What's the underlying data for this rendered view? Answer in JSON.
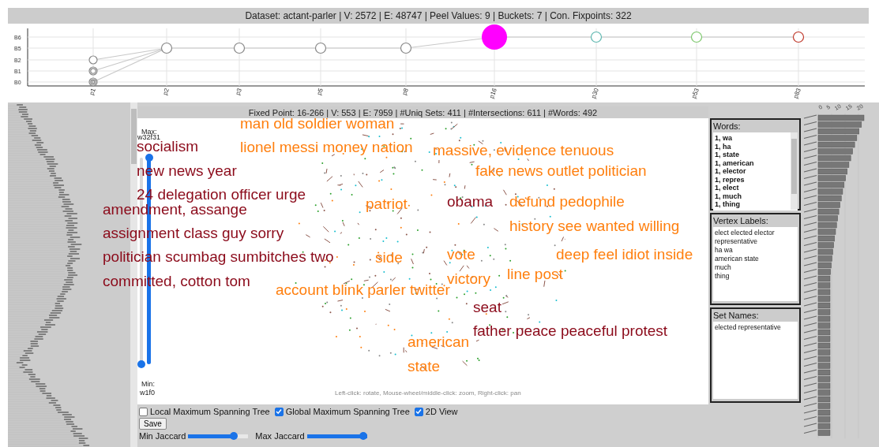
{
  "header": {
    "title": "Dataset: actant-parler | V: 2572 | E: 48747 | Peel Values: 9 | Buckets: 7 | Con. Fixpoints: 322"
  },
  "lattice": {
    "y_labels": [
      "B6",
      "B5",
      "B2",
      "B1",
      "B0"
    ],
    "columns": [
      {
        "label": "p1",
        "nodes": [
          {
            "kind": "spiral",
            "color": "#888888",
            "selected": false
          },
          {
            "kind": "spiral",
            "color": "#888888",
            "selected": false
          },
          {
            "kind": "spiral",
            "color": "#888888",
            "selected": false
          }
        ]
      },
      {
        "label": "p2",
        "nodes": [
          {
            "kind": "circle",
            "color": "#888888",
            "selected": false
          }
        ]
      },
      {
        "label": "p3",
        "nodes": [
          {
            "kind": "circle",
            "color": "#888888",
            "selected": false
          }
        ]
      },
      {
        "label": "p5",
        "nodes": [
          {
            "kind": "circle",
            "color": "#888888",
            "selected": false
          }
        ]
      },
      {
        "label": "p8",
        "nodes": [
          {
            "kind": "circle",
            "color": "#888888",
            "selected": false
          }
        ]
      },
      {
        "label": "p16",
        "nodes": [
          {
            "kind": "circle",
            "color": "#ff00ff",
            "selected": true
          }
        ]
      },
      {
        "label": "p30",
        "nodes": [
          {
            "kind": "circle",
            "color": "#5fb8b0",
            "selected": false
          }
        ]
      },
      {
        "label": "p53",
        "nodes": [
          {
            "kind": "circle",
            "color": "#7ec86e",
            "selected": false
          }
        ]
      },
      {
        "label": "p83",
        "nodes": [
          {
            "kind": "circle",
            "color": "#c0392b",
            "selected": false
          }
        ]
      }
    ]
  },
  "fixed_point": {
    "title": "Fixed Point: 16-266 | V: 553 | E: 7959 | #Uniq Sets: 411 | #Intersections: 611 | #Words: 492",
    "labels": [
      {
        "text": "man old soldier woman",
        "color": "#ff7f0e"
      },
      {
        "text": "socialism",
        "color": "#8b0a1a"
      },
      {
        "text": "lionel messi money nation",
        "color": "#ff7f0e"
      },
      {
        "text": "massive, evidence tenuous",
        "color": "#ff7f0e"
      },
      {
        "text": "new news year",
        "color": "#8b0a1a"
      },
      {
        "text": "fake news outlet politician",
        "color": "#ff7f0e"
      },
      {
        "text": "24 delegation officer urge",
        "color": "#8b0a1a"
      },
      {
        "text": "amendment, assange",
        "color": "#8b0a1a"
      },
      {
        "text": "patriot",
        "color": "#ff7f0e"
      },
      {
        "text": "obama",
        "color": "#8b0a1a"
      },
      {
        "text": "defund pedophile",
        "color": "#ff7f0e"
      },
      {
        "text": "assignment class guy sorry",
        "color": "#8b0a1a"
      },
      {
        "text": "history see wanted willing",
        "color": "#ff7f0e"
      },
      {
        "text": "politician scumbag sumbitches two",
        "color": "#8b0a1a"
      },
      {
        "text": "side",
        "color": "#ff7f0e"
      },
      {
        "text": "vote",
        "color": "#ff7f0e"
      },
      {
        "text": "deep feel idiot inside",
        "color": "#ff7f0e"
      },
      {
        "text": "line post",
        "color": "#ff7f0e"
      },
      {
        "text": "committed, cotton tom",
        "color": "#8b0a1a"
      },
      {
        "text": "victory",
        "color": "#ff7f0e"
      },
      {
        "text": "account blink parler twitter",
        "color": "#ff7f0e"
      },
      {
        "text": "seat",
        "color": "#8b0a1a"
      },
      {
        "text": "father peace peaceful protest",
        "color": "#8b0a1a"
      },
      {
        "text": "american",
        "color": "#ff7f0e"
      },
      {
        "text": "state",
        "color": "#ff7f0e"
      }
    ],
    "range_slider": {
      "max_label": "Max:",
      "max_value": "w32f31",
      "min_label": "Min:",
      "min_value": "w1f0"
    },
    "hint": "Left-click: rotate, Mouse-wheel/middle-click: zoom, Right-click: pan"
  },
  "controls": {
    "checkboxes": [
      {
        "label": "Local Maximum Spanning Tree",
        "checked": false
      },
      {
        "label": "Global Maximum Spanning Tree",
        "checked": true
      },
      {
        "label": "2D View",
        "checked": true
      }
    ],
    "save": "Save",
    "sliders": [
      {
        "label": "Min Jaccard",
        "level": 0.8
      },
      {
        "label": "Max Jaccard",
        "level": 1
      }
    ]
  },
  "panels": [
    {
      "title": "Words:",
      "kind": "scroll",
      "items": [
        "1, wa",
        "1, ha",
        "1, state",
        "1, american",
        "1, elector",
        "1, repres",
        "1, elect",
        "1, much",
        "1, thing"
      ]
    },
    {
      "title": "Vertex Labels:",
      "kind": "plain",
      "items": [
        "elect elected elector",
        "representative",
        "ha wa",
        "american state",
        "much",
        "thing"
      ]
    },
    {
      "title": "Set Names:",
      "kind": "plain",
      "items": [
        "elected representative"
      ]
    }
  ],
  "frequency_chart": {
    "ticks": [
      "0",
      "5",
      "10",
      "15",
      "20"
    ]
  }
}
